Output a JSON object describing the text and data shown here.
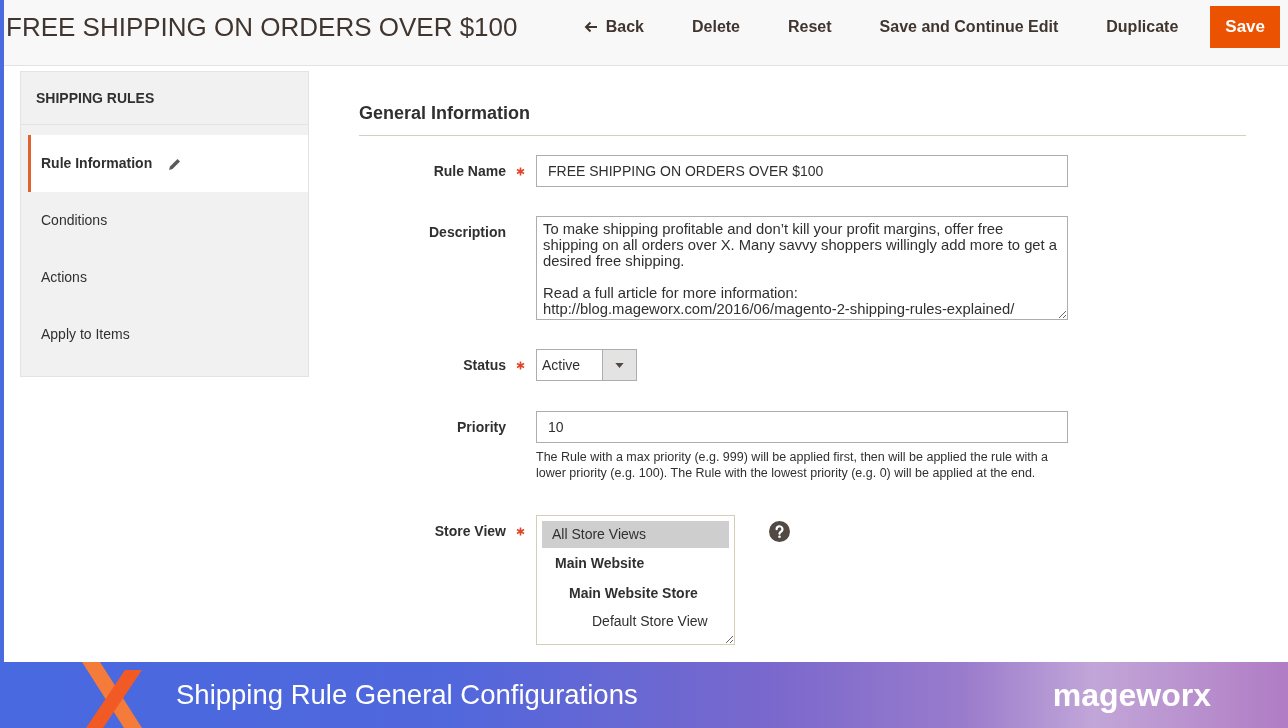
{
  "header": {
    "title": "FREE SHIPPING ON ORDERS OVER $100",
    "actions": [
      {
        "kind": "back",
        "label": "Back"
      },
      {
        "kind": "delete",
        "label": "Delete"
      },
      {
        "kind": "reset",
        "label": "Reset"
      },
      {
        "kind": "save_continue",
        "label": "Save and Continue Edit"
      },
      {
        "kind": "duplicate",
        "label": "Duplicate"
      },
      {
        "kind": "save",
        "label": "Save"
      }
    ]
  },
  "sidebar": {
    "title": "SHIPPING RULES",
    "items": [
      {
        "label": "Rule Information",
        "selected": true,
        "changed": true
      },
      {
        "label": "Conditions",
        "selected": false,
        "changed": false
      },
      {
        "label": "Actions",
        "selected": false,
        "changed": false
      },
      {
        "label": "Apply to Items",
        "selected": false,
        "changed": false
      }
    ]
  },
  "section": {
    "title": "General Information",
    "fields": [
      {
        "kind": "text",
        "label": "Rule Name",
        "required": true,
        "help": false,
        "value": "FREE SHIPPING ON ORDERS OVER $100"
      },
      {
        "kind": "textarea",
        "label": "Description",
        "required": false,
        "help": false,
        "value": "To make shipping profitable and don’t kill your profit margins, offer free shipping on all orders over X. Many savvy shoppers willingly add more to get a desired free shipping.\n\nRead a full article for more information:\nhttp://blog.mageworx.com/2016/06/magento-2-shipping-rules-explained/"
      },
      {
        "kind": "select",
        "label": "Status",
        "required": true,
        "help": false,
        "value": "Active"
      },
      {
        "kind": "text",
        "label": "Priority",
        "required": false,
        "help": false,
        "value": "10",
        "note": "The Rule with a max priority (e.g. 999) will be applied first, then will be applied the rule with a lower priority (e.g. 100). The Rule with the lowest priority (e.g. 0) will be applied at the end."
      },
      {
        "kind": "multiselect",
        "label": "Store View",
        "required": true,
        "help": true,
        "options": [
          {
            "kind": "option",
            "label": "All Store Views",
            "selected": true
          },
          {
            "kind": "group",
            "label": "Main Website",
            "selected": false,
            "children": [
              {
                "kind": "group",
                "label": "Main Website Store",
                "selected": false,
                "children": [
                  {
                    "kind": "option",
                    "label": "Default Store View",
                    "selected": false
                  }
                ]
              }
            ]
          }
        ]
      }
    ]
  },
  "banner": {
    "title": "Shipping Rule General Configurations",
    "logo": "mageworx"
  }
}
